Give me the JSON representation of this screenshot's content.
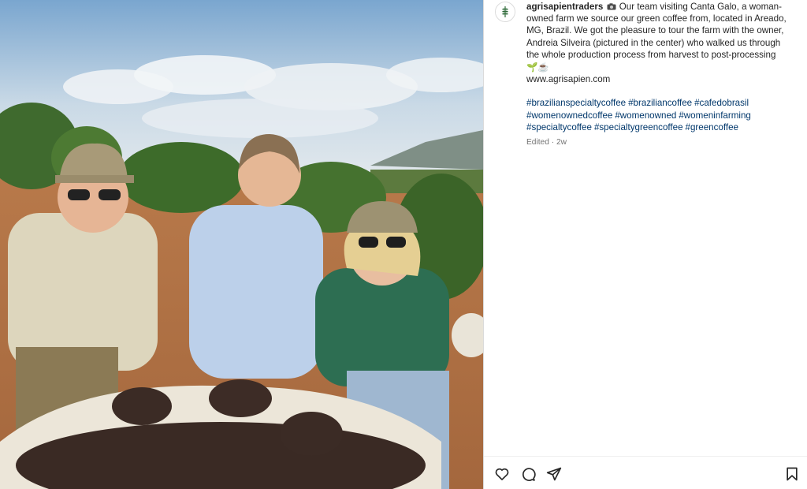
{
  "post": {
    "image_alt": "",
    "author": {
      "username": "agrisapientraders"
    },
    "caption": {
      "body": "Our team visiting Canta Galo, a woman-owned farm we source our green coffee from, located in Areado, MG, Brazil. We got the pleasure to tour the farm with the owner, Andreia Silveira (pictured in the center) who walked us through the whole production process from harvest to post-processing",
      "emoji_trail": "🌱☕",
      "website": "www.agrisapien.com",
      "hashtags": [
        "#brazilianspecialtycoffee",
        "#braziliancoffee",
        "#cafedobrasil",
        "#womenownedcoffee",
        "#womenowned",
        "#womeninfarming",
        "#specialtycoffee",
        "#specialtygreencoffee",
        "#greencoffee"
      ]
    },
    "edited_label": "Edited",
    "separator": "·",
    "time_ago": "2w"
  },
  "actions": {
    "like_icon": "heart-icon",
    "comment_icon": "comment-icon",
    "share_icon": "share-icon",
    "save_icon": "bookmark-icon"
  },
  "colors": {
    "text": "#262626",
    "hashtag": "#00376b",
    "muted": "#737373",
    "divider": "#dbdbdb"
  }
}
